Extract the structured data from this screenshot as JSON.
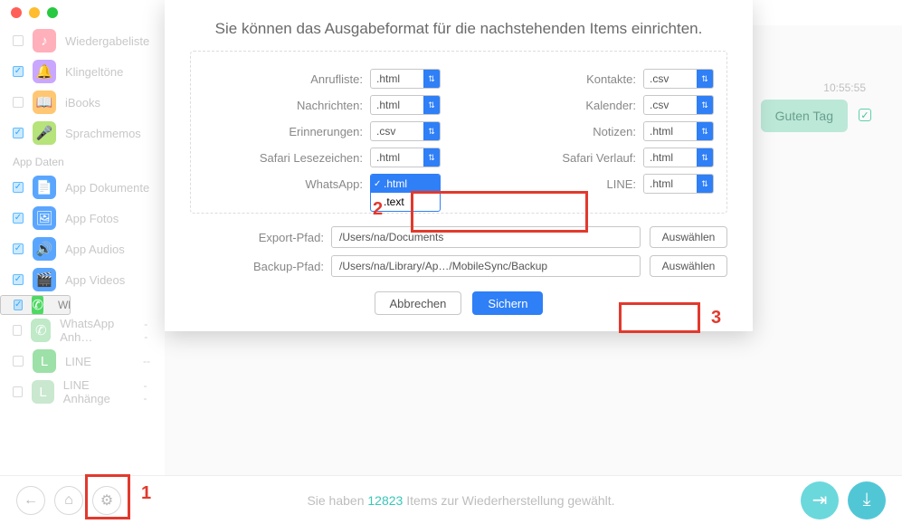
{
  "titlebar": {
    "close": "close-dot",
    "min": "min-dot",
    "max": "max-dot"
  },
  "sidebar": {
    "items": [
      {
        "label": "Wiedergabeliste",
        "checked": false,
        "color": "#ffb0bb",
        "glyph": "♪"
      },
      {
        "label": "Klingeltöne",
        "checked": true,
        "color": "#c9a7ff",
        "glyph": "🔔"
      },
      {
        "label": "iBooks",
        "checked": false,
        "color": "#ffc773",
        "glyph": "📖"
      },
      {
        "label": "Sprachmemos",
        "checked": true,
        "color": "#b6e37a",
        "glyph": "🎤"
      }
    ],
    "header": "App Daten",
    "apps": [
      {
        "label": "App Dokumente",
        "checked": true,
        "color": "#5aa6ff",
        "glyph": "📄"
      },
      {
        "label": "App Fotos",
        "checked": true,
        "color": "#5aa6ff",
        "glyph": "🖼"
      },
      {
        "label": "App Audios",
        "checked": true,
        "color": "#5aa6ff",
        "glyph": "🔊"
      },
      {
        "label": "App Videos",
        "checked": true,
        "color": "#5aa6ff",
        "glyph": "🎬"
      },
      {
        "label": "WhatsApp",
        "checked": true,
        "color": "#4fd964",
        "glyph": "✆",
        "selected": true
      },
      {
        "label": "WhatsApp Anh…",
        "checked": false,
        "color": "#bfe9c7",
        "glyph": "✆",
        "dash": "--"
      },
      {
        "label": "LINE",
        "checked": false,
        "color": "#9de0a8",
        "glyph": "L",
        "dash": "--"
      },
      {
        "label": "LINE Anhänge",
        "checked": false,
        "color": "#c9e8cf",
        "glyph": "L",
        "dash": "--"
      }
    ]
  },
  "chat": {
    "time": "10:55:55",
    "bubble": "Guten Tag"
  },
  "modal": {
    "title": "Sie können das Ausgabeformat für die nachstehenden Items einrichten.",
    "formats": {
      "left": [
        {
          "label": "Anrufliste:",
          "value": ".html"
        },
        {
          "label": "Nachrichten:",
          "value": ".html"
        },
        {
          "label": "Erinnerungen:",
          "value": ".csv"
        },
        {
          "label": "Safari Lesezeichen:",
          "value": ".html"
        },
        {
          "label": "WhatsApp:",
          "value": ".html",
          "open": true,
          "options": [
            ".html",
            ".text"
          ]
        }
      ],
      "right": [
        {
          "label": "Kontakte:",
          "value": ".csv"
        },
        {
          "label": "Kalender:",
          "value": ".csv"
        },
        {
          "label": "Notizen:",
          "value": ".html"
        },
        {
          "label": "Safari Verlauf:",
          "value": ".html"
        },
        {
          "label": "LINE:",
          "value": ".html"
        }
      ]
    },
    "export_label": "Export-Pfad:",
    "export_path": "/Users/na/Documents",
    "backup_label": "Backup-Pfad:",
    "backup_path": "/Users/na/Library/Ap…/MobileSync/Backup",
    "choose": "Auswählen",
    "cancel": "Abbrechen",
    "save": "Sichern"
  },
  "bottom": {
    "msg_pre": "Sie haben ",
    "count": "12823",
    "msg_post": " Items zur Wiederherstellung gewählt."
  },
  "callouts": {
    "1": "1",
    "2": "2",
    "3": "3"
  }
}
